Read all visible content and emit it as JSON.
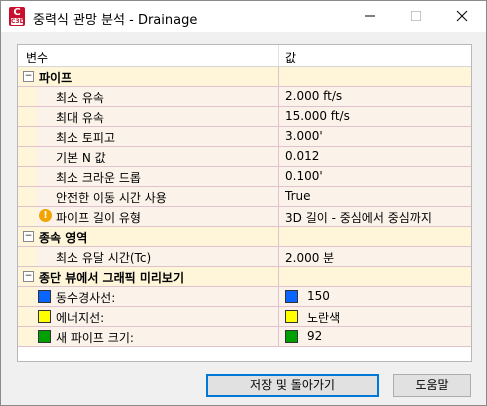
{
  "window": {
    "title": "중력식 관망 분석 - Drainage",
    "icon_text": "C",
    "icon_sub": "C3D"
  },
  "grid": {
    "header": {
      "col1": "변수",
      "col2": "값"
    },
    "categories": [
      {
        "label": "파이프",
        "toggle": "−",
        "props": [
          {
            "label": "최소 유속",
            "value": "2.000 ft/s"
          },
          {
            "label": "최대 유속",
            "value": "15.000 ft/s"
          },
          {
            "label": "최소 토피고",
            "value": "3.000'"
          },
          {
            "label": "기본 N 값",
            "value": "0.012"
          },
          {
            "label": "최소 크라운 드롭",
            "value": "0.100'"
          },
          {
            "label": "안전한 이동 시간 사용",
            "value": "True"
          },
          {
            "label": "파이프 길이 유형",
            "value": "3D 길이 - 중심에서 중심까지",
            "warn": "!"
          }
        ]
      },
      {
        "label": "종속 영역",
        "toggle": "−",
        "props": [
          {
            "label": "최소 유달 시간(Tc)",
            "value": "2.000 분"
          }
        ]
      },
      {
        "label": "종단 뷰에서 그래픽 미리보기",
        "toggle": "−",
        "props": [
          {
            "label": "동수경사선:",
            "value": "150",
            "color": "#0a64ff"
          },
          {
            "label": "에너지선:",
            "value": "노란색",
            "color": "#ffff00"
          },
          {
            "label": "새 파이프 크기:",
            "value": "92",
            "color": "#00a000"
          }
        ]
      }
    ]
  },
  "buttons": {
    "save_return": "저장 및 돌아가기",
    "help": "도움말"
  },
  "colors": {
    "category_bg": "#fff6d9",
    "prop_bg": "#fbf3ea",
    "grid_line": "#e0c2cf",
    "focus": "#0078d7"
  }
}
